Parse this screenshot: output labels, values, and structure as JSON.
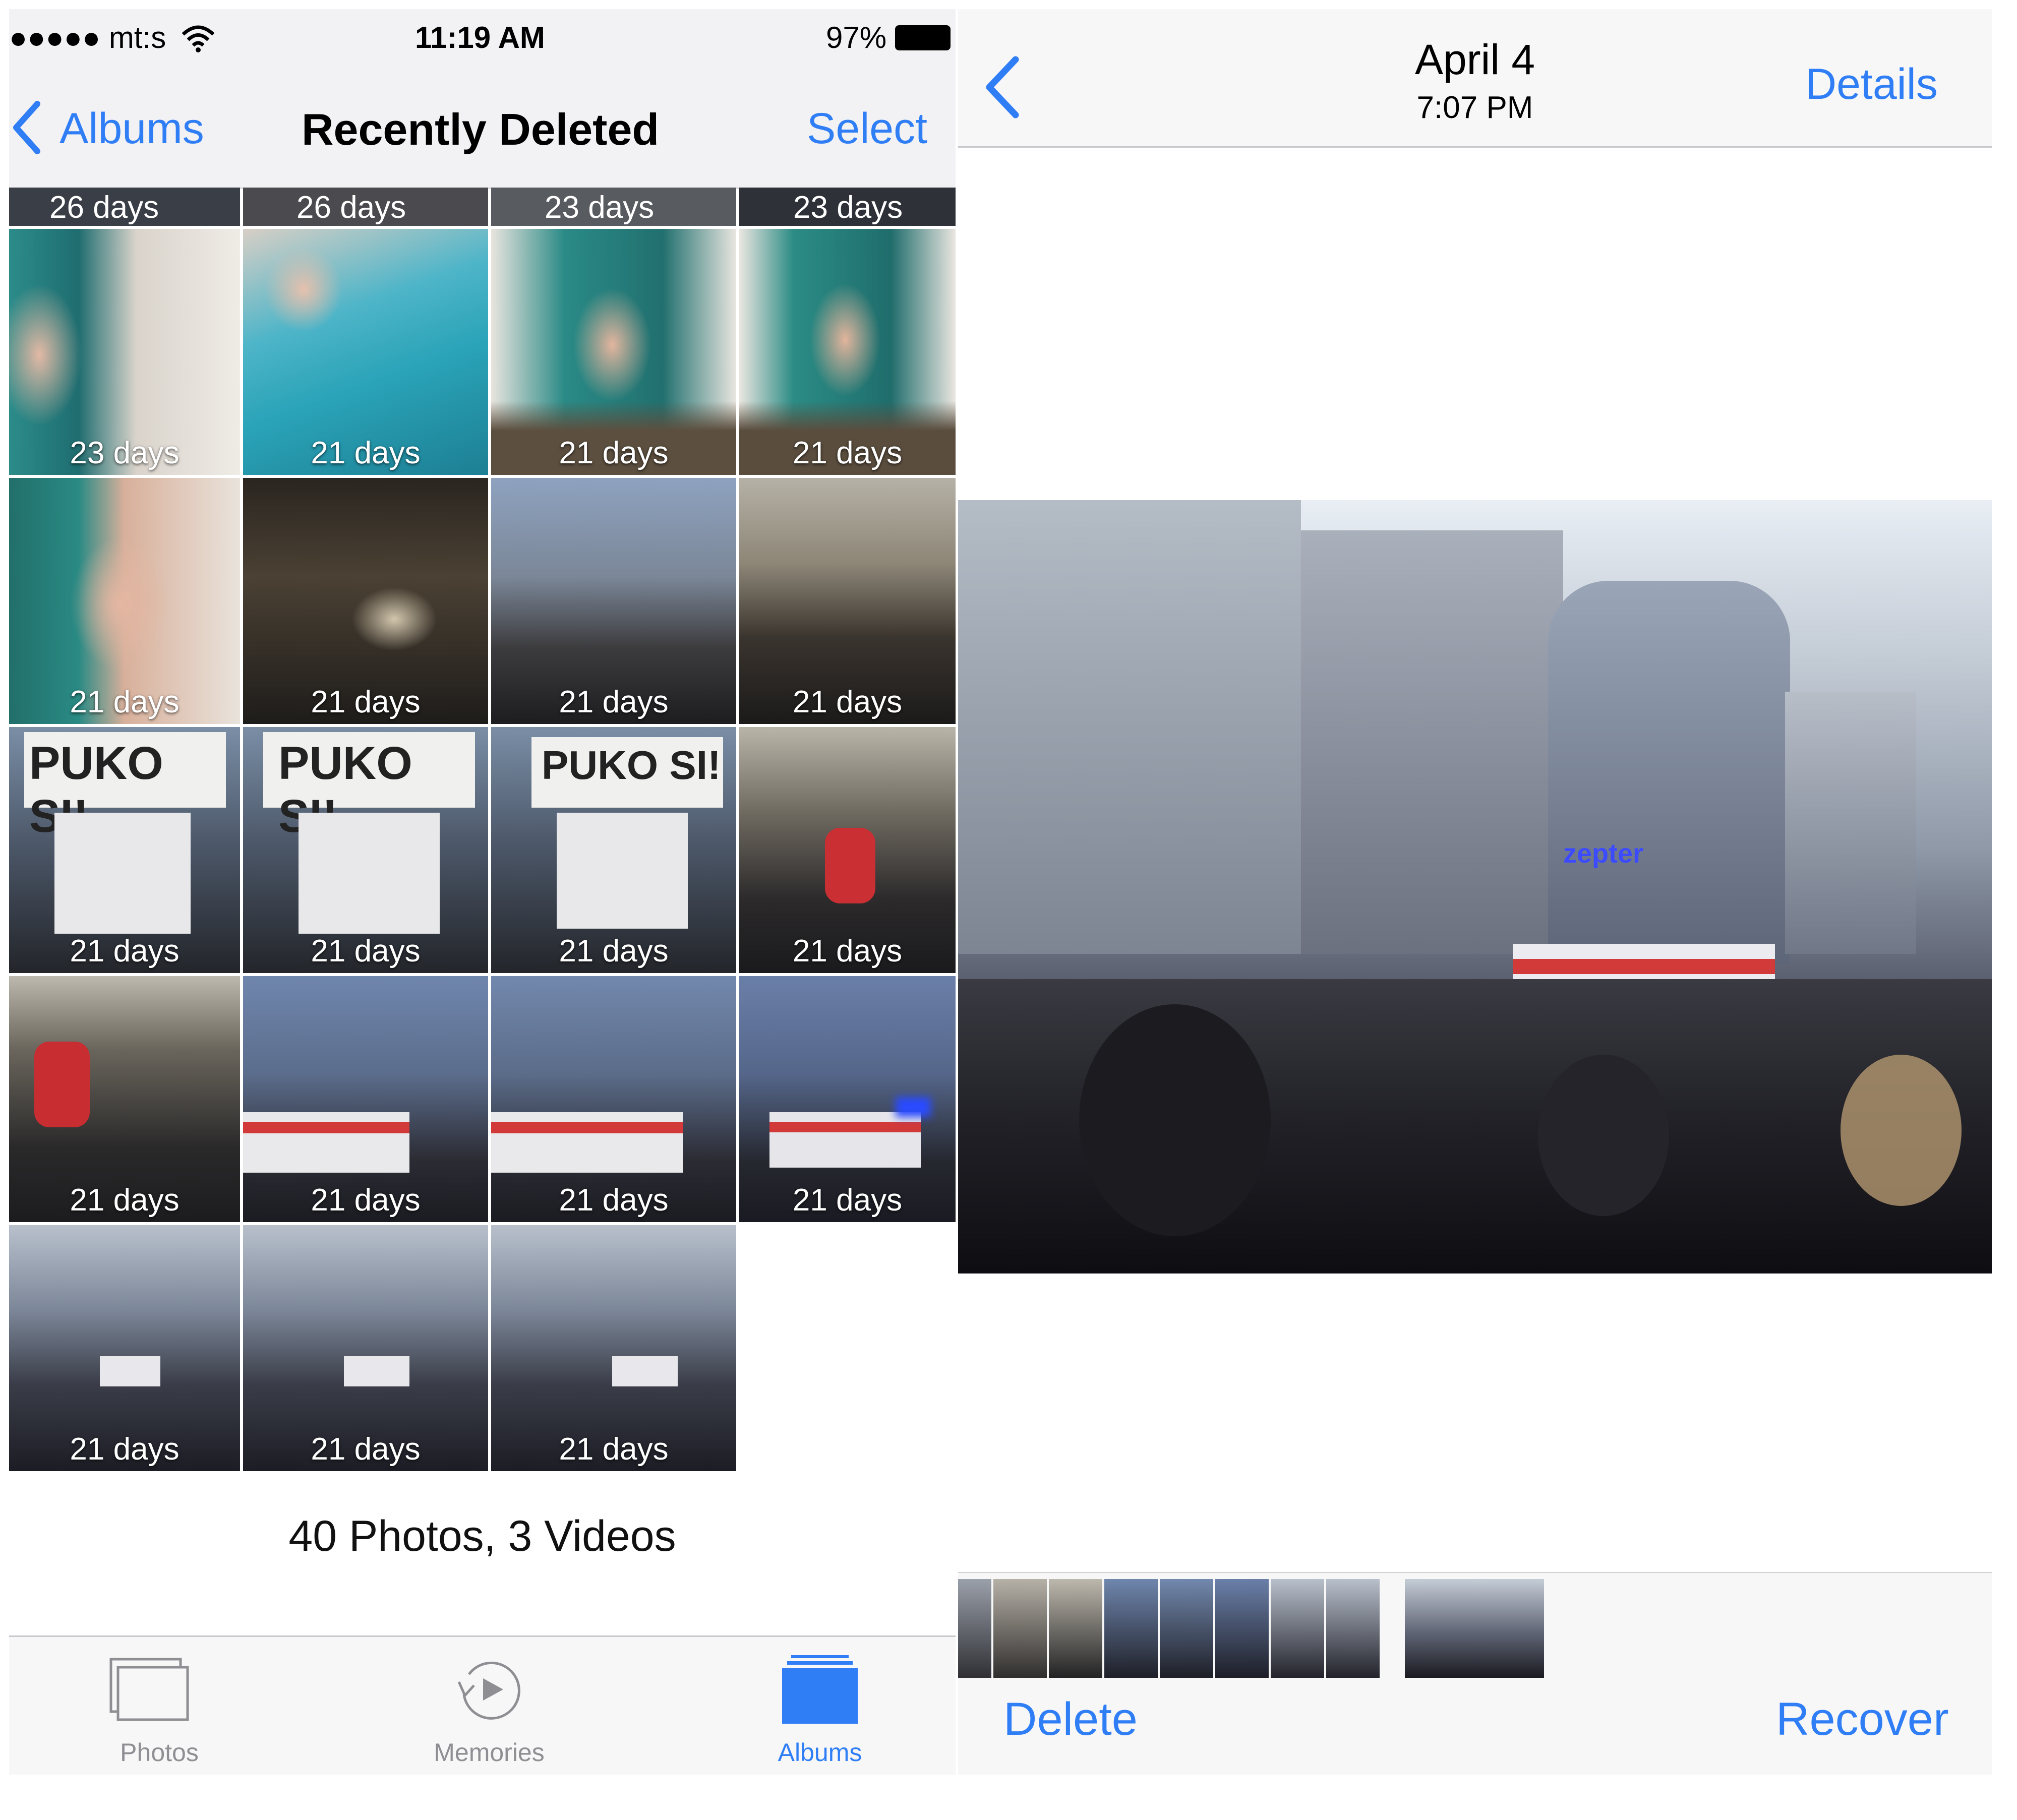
{
  "left_screen": {
    "status_bar": {
      "carrier": "●●●●● mt:s",
      "time": "11:19 AM",
      "battery": "97%",
      "icons": [
        "wifi-icon",
        "battery-icon"
      ]
    },
    "nav": {
      "back_label": "Albums",
      "title": "Recently Deleted",
      "select_label": "Select"
    },
    "top_row_labels": [
      "26 days",
      "26 days",
      "23 days",
      "23 days"
    ],
    "grid_rows": [
      [
        "23 days",
        "21 days",
        "21 days",
        "21 days"
      ],
      [
        "21 days",
        "21 days",
        "21 days",
        "21 days"
      ],
      [
        "21 days",
        "21 days",
        "21 days",
        "21 days"
      ],
      [
        "21 days",
        "21 days",
        "21 days",
        "21 days"
      ],
      [
        "21 days",
        "21 days",
        "21 days"
      ]
    ],
    "sign_text": "PUKO SI!",
    "count_text": "40 Photos, 3 Videos",
    "tabs": [
      {
        "label": "Photos",
        "icon": "photos-icon",
        "active": false
      },
      {
        "label": "Memories",
        "icon": "memories-icon",
        "active": false
      },
      {
        "label": "Albums",
        "icon": "albums-icon",
        "active": true
      }
    ]
  },
  "right_screen": {
    "nav": {
      "date": "April 4",
      "time": "7:07 PM",
      "details_label": "Details",
      "back_icon": "chevron-left-icon"
    },
    "photo_sign_text": "zepter",
    "toolbar": {
      "delete_label": "Delete",
      "recover_label": "Recover"
    }
  },
  "colors": {
    "accent": "#2f7ef6",
    "bar_bg": "#f7f7f8",
    "inactive_tab": "#8e8e93"
  }
}
